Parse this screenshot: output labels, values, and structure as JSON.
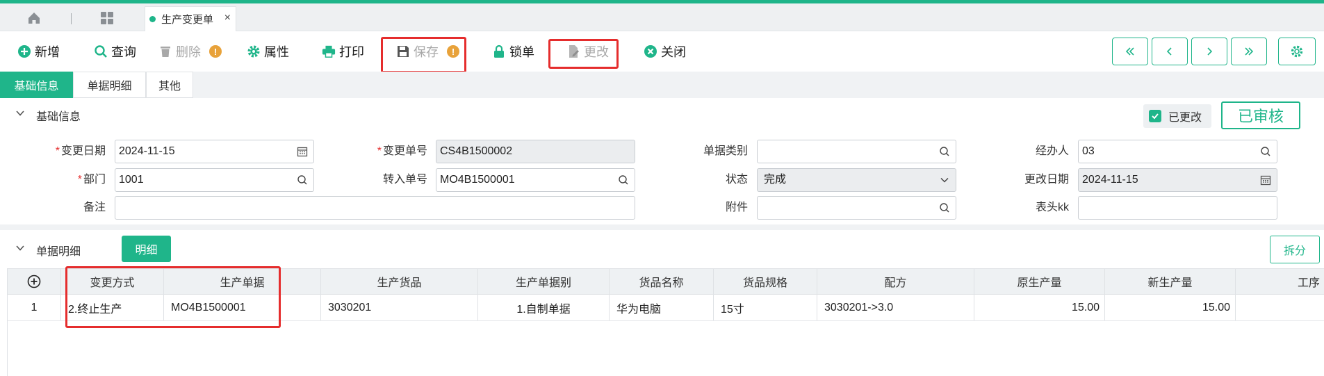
{
  "tabs": {
    "home_icon": "home-icon",
    "apps_icon": "grid-icon",
    "doc_tab_label": "生产变更单",
    "close_glyph": "×"
  },
  "toolbar": {
    "buttons": [
      {
        "key": "add",
        "label": "新增",
        "icon": "plus-circle-icon",
        "disabled": false
      },
      {
        "key": "query",
        "label": "查询",
        "icon": "search-icon",
        "disabled": false
      },
      {
        "key": "delete",
        "label": "删除",
        "icon": "trash-icon",
        "disabled": true,
        "warning": "!"
      },
      {
        "key": "props",
        "label": "属性",
        "icon": "gear-icon",
        "disabled": false
      },
      {
        "key": "print",
        "label": "打印",
        "icon": "printer-icon",
        "disabled": false
      },
      {
        "key": "save",
        "label": "保存",
        "icon": "save-icon",
        "disabled": true,
        "warning": "!"
      },
      {
        "key": "lock",
        "label": "锁单",
        "icon": "lock-icon",
        "disabled": false
      },
      {
        "key": "modify",
        "label": "更改",
        "icon": "edit-doc-icon",
        "disabled": true
      },
      {
        "key": "close",
        "label": "关闭",
        "icon": "close-circle-icon",
        "disabled": false
      }
    ],
    "nav": [
      "first-page-icon",
      "prev-page-icon",
      "next-page-icon",
      "last-page-icon"
    ],
    "settings_icon": "gear-icon"
  },
  "subtabs": [
    "基础信息",
    "单据明细",
    "其他"
  ],
  "basic": {
    "section_title": "基础信息",
    "changed_label": "已更改",
    "status_stamp": "已审核",
    "fields": {
      "change_date": {
        "label": "变更日期",
        "required": "*",
        "value": "2024-11-15"
      },
      "change_no": {
        "label": "变更单号",
        "required": "*",
        "value": "CS4B1500002"
      },
      "doc_type": {
        "label": "单据类别",
        "value": ""
      },
      "handler": {
        "label": "经办人",
        "value": "03"
      },
      "dept": {
        "label": "部门",
        "required": "*",
        "value": "1001"
      },
      "source_no": {
        "label": "转入单号",
        "value": "MO4B1500001"
      },
      "status": {
        "label": "状态",
        "value": "完成"
      },
      "modify_date": {
        "label": "更改日期",
        "value": "2024-11-15"
      },
      "remark": {
        "label": "备注",
        "value": ""
      },
      "attachment": {
        "label": "附件",
        "value": ""
      },
      "header_kk": {
        "label": "表头kk",
        "value": ""
      }
    }
  },
  "detail": {
    "section_title": "单据明细",
    "detail_button": "明细",
    "split_button": "拆分",
    "columns": [
      "变更方式",
      "生产单据",
      "生产货品",
      "生产单据别",
      "货品名称",
      "货品规格",
      "配方",
      "原生产量",
      "新生产量",
      "工序"
    ],
    "rows": [
      {
        "no": "1",
        "cells": [
          "2.终止生产",
          "MO4B1500001",
          "3030201",
          "1.自制单据",
          "华为电脑",
          "15寸",
          "3030201->3.0",
          "15.00",
          "15.00",
          ""
        ]
      }
    ]
  },
  "colors": {
    "accent": "#1fb58a",
    "highlight": "#e52d2d",
    "warning": "#e8a23a"
  }
}
